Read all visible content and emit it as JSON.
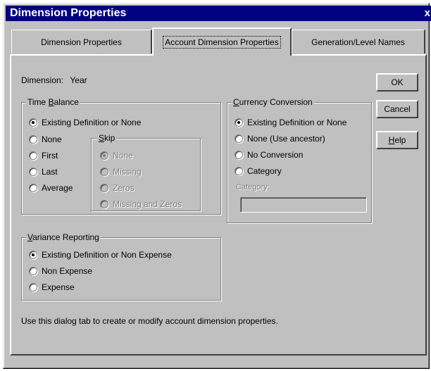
{
  "window": {
    "title": "Dimension Properties",
    "close_glyph": "x"
  },
  "tabs": [
    {
      "label": "Dimension Properties"
    },
    {
      "label": "Account Dimension Properties"
    },
    {
      "label": "Generation/Level Names"
    }
  ],
  "dimension": {
    "label": "Dimension:",
    "value": "Year"
  },
  "time_balance": {
    "legend_pre": "Time ",
    "legend_key": "B",
    "legend_post": "alance",
    "options": [
      {
        "label": "Existing Definition or None",
        "checked": true
      },
      {
        "label": "None",
        "checked": false
      },
      {
        "label": "First",
        "checked": false
      },
      {
        "label": "Last",
        "checked": false
      },
      {
        "label": "Average",
        "checked": false
      }
    ]
  },
  "skip": {
    "legend_key": "S",
    "legend_post": "kip",
    "options": [
      {
        "label": "None",
        "checked": true
      },
      {
        "label": "Missing",
        "checked": false
      },
      {
        "label": "Zeros",
        "checked": false
      },
      {
        "label": "Missing and Zeros",
        "checked": false
      }
    ]
  },
  "currency_conversion": {
    "legend_key": "C",
    "legend_post": "urrency Conversion",
    "options": [
      {
        "label": "Existing Definition or None",
        "checked": true
      },
      {
        "label": "None (Use ancestor)",
        "checked": false
      },
      {
        "label": "No Conversion",
        "checked": false
      },
      {
        "label": "Category",
        "checked": false
      }
    ],
    "category_label": "Category:",
    "category_value": ""
  },
  "variance_reporting": {
    "legend_key": "V",
    "legend_post": "ariance Reporting",
    "options": [
      {
        "label": "Existing Definition or Non Expense",
        "checked": true
      },
      {
        "label": "Non Expense",
        "checked": false
      },
      {
        "label": "Expense",
        "checked": false
      }
    ]
  },
  "buttons": {
    "ok": "OK",
    "cancel": "Cancel",
    "help_key": "H",
    "help_rest": "elp"
  },
  "help_text": "Use this dialog tab to create or modify account dimension properties.",
  "colors": {
    "titlebar": "#000080",
    "face": "#c0c0c0"
  }
}
